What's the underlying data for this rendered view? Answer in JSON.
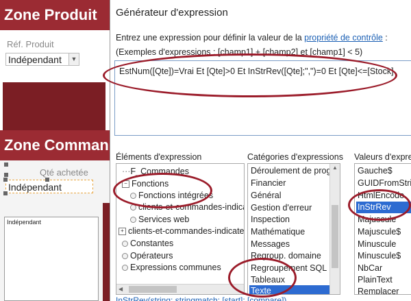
{
  "form": {
    "zone_produit": "Zone Produit",
    "ref_label": "Réf. Produit",
    "ref_value": "Indépendant",
    "zone_commande": "Zone Comman",
    "qte_label": "Qté achetée",
    "qte_value": "Indépendant",
    "subform_text": "Indépendant"
  },
  "dialog": {
    "title": "Générateur d'expression",
    "instruction_prefix": "Entrez une expression pour définir la valeur de la ",
    "instruction_link": "propriété de contrôle",
    "instruction_suffix": " :",
    "examples": "(Exemples d'expressions : [champ1] + [champ2] et [champ1] < 5)",
    "expression": "EstNum([Qte])=Vrai Et [Qte]>0 Et InStrRev([Qte];\",\")=0 Et [Qte]<=[Stock]",
    "col_elements": "Éléments d'expression",
    "col_categories": "Catégories d'expressions",
    "col_valeurs": "Valeurs d'expres",
    "elements": [
      {
        "label": "F_Commandes",
        "icon": "tree-connector"
      },
      {
        "label": "Fonctions",
        "icon": "collapse-icon"
      },
      {
        "label": "Fonctions intégrées",
        "icon": "function-icon"
      },
      {
        "label": "clients-et-commandes-indicate",
        "icon": "function-icon"
      },
      {
        "label": "Services web",
        "icon": "function-icon"
      },
      {
        "label": "clients-et-commandes-indicateu",
        "icon": "expand-icon"
      },
      {
        "label": "Constantes",
        "icon": "constant-icon"
      },
      {
        "label": "Opérateurs",
        "icon": "operator-icon"
      },
      {
        "label": "Expressions communes",
        "icon": "expression-icon"
      }
    ],
    "categories": [
      "Déroulement de program",
      "Financier",
      "Général",
      "Gestion d'erreur",
      "Inspection",
      "Mathématique",
      "Messages",
      "Regroup. domaine",
      "Regroupement SQL",
      "Tableaux",
      "Texte"
    ],
    "categories_selected": "Texte",
    "valeurs": [
      "Gauche$",
      "GUIDFromString",
      "HtmlEncode",
      "InStrRev",
      "Majuscule",
      "Majuscule$",
      "Minuscule",
      "Minuscule$",
      "NbCar",
      "PlainText",
      "Remplacer"
    ],
    "valeurs_selected": "InStrRev",
    "syntax": "InStrRev(string; stringmatch; [start]; [compare])"
  },
  "colors": {
    "brand": "#9b2b33",
    "selection": "#2d6bd1",
    "annotation": "#9b1c2a",
    "link": "#1a5fb4"
  }
}
